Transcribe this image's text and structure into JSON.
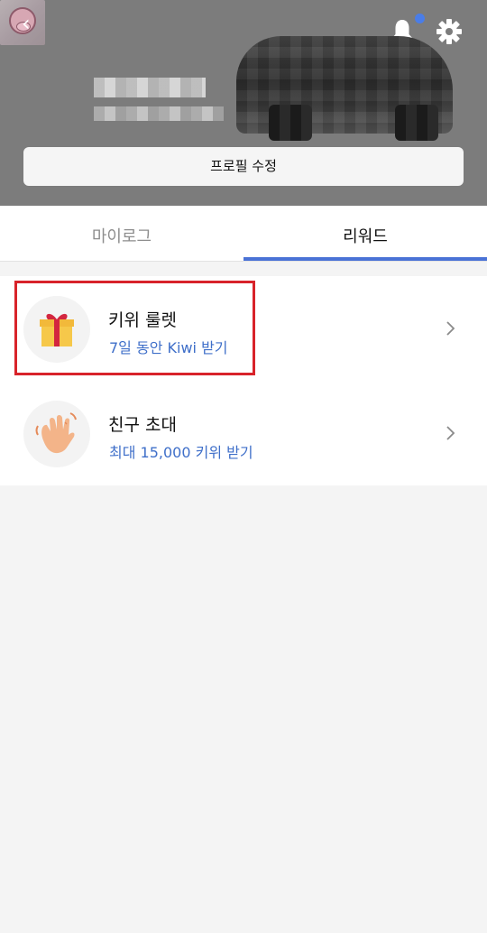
{
  "header": {
    "edit_profile_label": "프로필 수정"
  },
  "tabs": [
    {
      "label": "마이로그",
      "selected": false
    },
    {
      "label": "리워드",
      "selected": true
    }
  ],
  "rewards": [
    {
      "title": "키위 룰렛",
      "subtitle": "7일 동안 Kiwi 받기",
      "icon": "gift-icon"
    },
    {
      "title": "친구 초대",
      "subtitle": "최대 15,000 키위 받기",
      "icon": "waving-hand-icon"
    }
  ],
  "colors": {
    "header_bg": "#7c7c7c",
    "accent": "#4a72d6",
    "link_text": "#3f6fc9",
    "highlight": "#d8232a",
    "notification_dot": "#4a7de8"
  }
}
